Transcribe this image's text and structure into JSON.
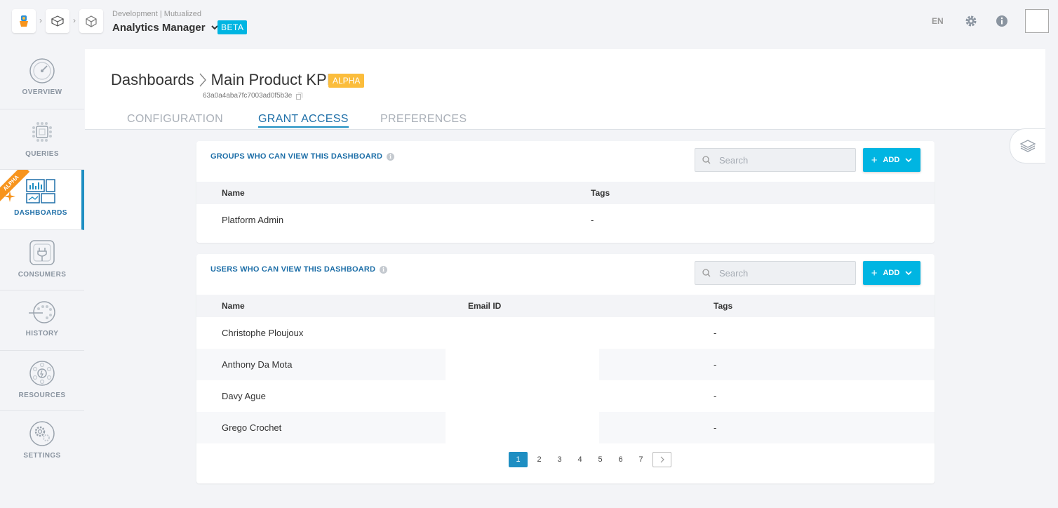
{
  "topbar": {
    "environment": "Development | Mutualized",
    "app_title": "Analytics Manager",
    "beta_badge": "BETA",
    "language": "EN"
  },
  "sidebar": {
    "items": [
      {
        "label": "OVERVIEW",
        "icon": "gauge-icon"
      },
      {
        "label": "QUERIES",
        "icon": "chip-icon"
      },
      {
        "label": "DASHBOARDS",
        "icon": "dashboard-icon",
        "active": true,
        "ribbon": "ALPHA"
      },
      {
        "label": "CONSUMERS",
        "icon": "plug-icon"
      },
      {
        "label": "HISTORY",
        "icon": "timeline-icon"
      },
      {
        "label": "RESOURCES",
        "icon": "resources-icon"
      },
      {
        "label": "SETTINGS",
        "icon": "gears-icon"
      }
    ]
  },
  "header": {
    "breadcrumb_root": "Dashboards",
    "breadcrumb_current": "Main Product KPIs",
    "alpha_badge": "ALPHA",
    "dashboard_id": "63a0a4aba7fc7003ad0f5b3e",
    "tabs": [
      {
        "label": "CONFIGURATION",
        "active": false
      },
      {
        "label": "GRANT ACCESS",
        "active": true
      },
      {
        "label": "PREFERENCES",
        "active": false
      }
    ]
  },
  "groups_card": {
    "title": "GROUPS WHO CAN VIEW THIS DASHBOARD",
    "search_placeholder": "Search",
    "add_label": "ADD",
    "columns": [
      "Name",
      "Tags"
    ],
    "rows": [
      {
        "name": "Platform Admin",
        "tags": "-"
      }
    ]
  },
  "users_card": {
    "title": "USERS WHO CAN VIEW THIS DASHBOARD",
    "search_placeholder": "Search",
    "add_label": "ADD",
    "columns": [
      "Name",
      "Email ID",
      "Tags"
    ],
    "rows": [
      {
        "name": "Christophe Ploujoux",
        "email": "",
        "tags": "-"
      },
      {
        "name": "Anthony Da Mota",
        "email": "",
        "tags": "-"
      },
      {
        "name": "Davy Ague",
        "email": "",
        "tags": "-"
      },
      {
        "name": "Grego Crochet",
        "email": "",
        "tags": "-"
      }
    ],
    "pagination": [
      "1",
      "2",
      "3",
      "4",
      "5",
      "6",
      "7"
    ],
    "current_page": "1"
  },
  "colors": {
    "accent": "#00b5e2",
    "primary": "#1e8ec2",
    "alpha": "#fbbd3c",
    "ribbon": "#f7941d"
  }
}
